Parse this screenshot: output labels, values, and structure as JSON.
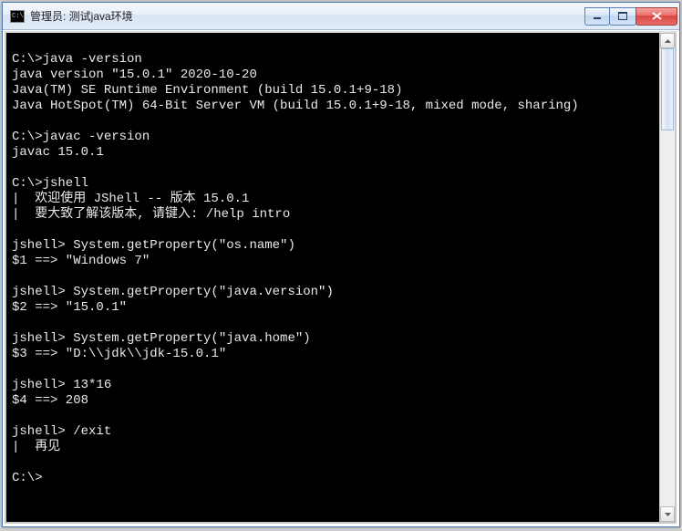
{
  "titlebar": {
    "icon_text": "C:\\",
    "title": "管理员: 测试java环境"
  },
  "terminal": {
    "lines": [
      "",
      "C:\\>java -version",
      "java version \"15.0.1\" 2020-10-20",
      "Java(TM) SE Runtime Environment (build 15.0.1+9-18)",
      "Java HotSpot(TM) 64-Bit Server VM (build 15.0.1+9-18, mixed mode, sharing)",
      "",
      "C:\\>javac -version",
      "javac 15.0.1",
      "",
      "C:\\>jshell",
      "|  欢迎使用 JShell -- 版本 15.0.1",
      "|  要大致了解该版本, 请键入: /help intro",
      "",
      "jshell> System.getProperty(\"os.name\")",
      "$1 ==> \"Windows 7\"",
      "",
      "jshell> System.getProperty(\"java.version\")",
      "$2 ==> \"15.0.1\"",
      "",
      "jshell> System.getProperty(\"java.home\")",
      "$3 ==> \"D:\\\\jdk\\\\jdk-15.0.1\"",
      "",
      "jshell> 13*16",
      "$4 ==> 208",
      "",
      "jshell> /exit",
      "|  再见",
      "",
      "C:\\>"
    ]
  }
}
